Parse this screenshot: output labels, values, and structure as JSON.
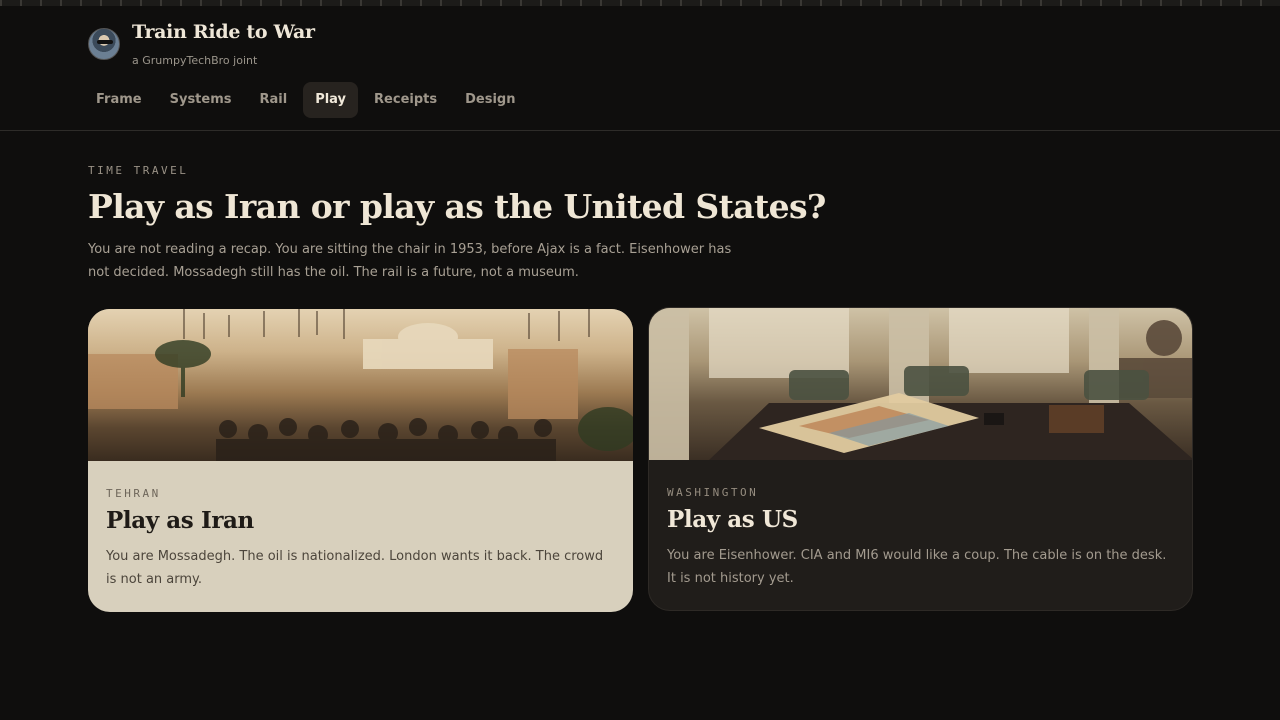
{
  "site": {
    "title": "Train Ride to War",
    "subtitle": "a GrumpyTechBro joint"
  },
  "nav": {
    "items": [
      {
        "label": "Frame",
        "active": false
      },
      {
        "label": "Systems",
        "active": false
      },
      {
        "label": "Rail",
        "active": false
      },
      {
        "label": "Play",
        "active": true
      },
      {
        "label": "Receipts",
        "active": false
      },
      {
        "label": "Design",
        "active": false
      }
    ]
  },
  "hero": {
    "eyebrow": "TIME TRAVEL",
    "title": "Play as Iran or play as the United States?",
    "lead": "You are not reading a recap. You are sitting the chair in 1953, before Ajax is a fact. Eisenhower has not decided. Mossadegh still has the oil. The rail is a future, not a museum."
  },
  "cards": [
    {
      "kicker": "TEHRAN",
      "title": "Play as Iran",
      "text": "You are Mossadegh. The oil is nationalized. London wants it back. The crowd is not an army.",
      "image": "tehran-crowd-illustration"
    },
    {
      "kicker": "WASHINGTON",
      "title": "Play as US",
      "text": "You are Eisenhower. CIA and MI6 would like a coup. The cable is on the desk. It is not history yet.",
      "image": "washington-office-map-illustration"
    }
  ],
  "colors": {
    "background": "#0f0e0d",
    "card_light": "#d8d0bd",
    "card_dark": "#201d1a",
    "nav_active": "#27231f",
    "text_primary": "#efe6d5"
  }
}
